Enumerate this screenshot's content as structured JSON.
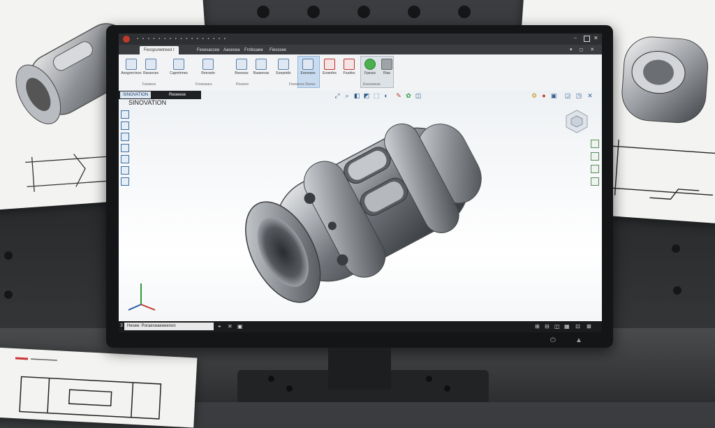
{
  "app": {
    "tabs": [
      {
        "label": "Fesspunetreed r"
      },
      {
        "label": "Fesesaccee"
      },
      {
        "label": "Aasesea"
      },
      {
        "label": "Frsfesaee"
      },
      {
        "label": "Fiesssee"
      }
    ],
    "window_controls": [
      "minimize-icon",
      "maximize-icon",
      "close-icon"
    ]
  },
  "ribbon": {
    "buttons": [
      {
        "label": "Aesgrerctess",
        "icon": "new-sketch-icon"
      },
      {
        "label": "Rasseses",
        "icon": "part-icon"
      },
      {
        "label": "Capmtrmes",
        "icon": "extrude-icon"
      },
      {
        "label": "Renrarte",
        "icon": "revolve-icon"
      },
      {
        "label": "Bsesnas",
        "icon": "fillet-icon"
      },
      {
        "label": "Raaeenas",
        "icon": "chamfer-icon"
      },
      {
        "label": "Eeepetds",
        "icon": "shell-icon"
      },
      {
        "label": "Ereneses",
        "icon": "pattern-icon"
      },
      {
        "label": "Ersenfes",
        "icon": "mirror-icon"
      },
      {
        "label": "Fruefes",
        "icon": "hole-icon"
      },
      {
        "label": "Fpesss",
        "icon": "appearance-icon"
      },
      {
        "label": "Rias",
        "icon": "render-icon"
      }
    ],
    "groups": [
      "Faneess",
      "Fonesears",
      "Pessers",
      "Feeneess Deess",
      "Eoesseeas"
    ]
  },
  "feature_tree": {
    "tabs": [
      "SINOVATION",
      "Reoeese"
    ],
    "model_name": "SINOVATION"
  },
  "status_bar": {
    "text": "Hesee: Poraeseaeeeenon"
  },
  "colors": {
    "accent": "#3d6ea3",
    "ribbon_bg": "#f2f3f4",
    "titlebar": "#2d2f32",
    "status_bg": "#1a1b1d",
    "highlight": "#c9dcef"
  }
}
